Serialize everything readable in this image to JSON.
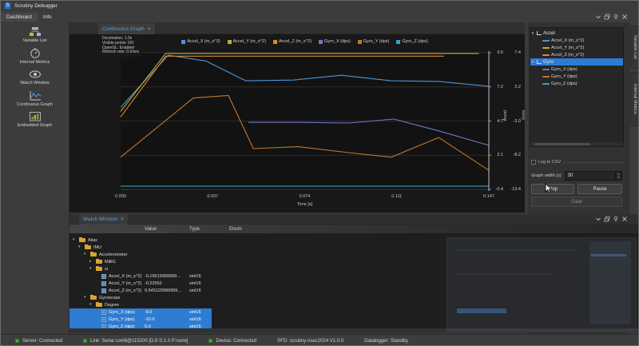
{
  "window": {
    "title": "Scrutiny Debugger",
    "app_initial": "S"
  },
  "menu": {
    "items": [
      "Dashboard",
      "Info"
    ]
  },
  "sidebar": {
    "items": [
      "Variable List",
      "Internal Metrics",
      "Watch Window",
      "Continuous Graph",
      "Embedded Graph"
    ]
  },
  "graph_dock": {
    "tab_label": "Continuous Graph",
    "close_glyph": "×",
    "overlay_lines": [
      "Decimation: 1.0x",
      "Visible points: 0/0",
      "OpenGL: Enabled",
      "Refresh rate: 0.0/sec"
    ],
    "x_label": "Time [s]"
  },
  "chart_data": {
    "type": "line",
    "title": "Continuous Graph",
    "xlabel": "Time [s]",
    "x_ticks": [
      "0.000",
      "0.037",
      "0.074",
      "0.111",
      "0.147"
    ],
    "grid": "horizontal",
    "legend_position": "top",
    "axes": [
      {
        "id": "accel",
        "label": "Accel",
        "ticks": [
          "9.6",
          "7.2",
          "4.7",
          "2.1",
          "-0.4"
        ]
      },
      {
        "id": "gyro",
        "label": "Gyro",
        "ticks": [
          "7.4",
          "2.2",
          "-3.0",
          "-8.2",
          "-13.4"
        ]
      }
    ],
    "series": [
      {
        "name": "Accel_X (m_s^2)",
        "axis": "accel",
        "color": "#4d94d8",
        "points": [
          [
            0.0,
            5.6
          ],
          [
            0.019,
            9.42
          ],
          [
            0.034,
            9.0
          ],
          [
            0.05,
            7.55
          ],
          [
            0.069,
            7.6
          ],
          [
            0.088,
            7.95
          ],
          [
            0.108,
            7.55
          ],
          [
            0.127,
            7.5
          ],
          [
            0.147,
            7.15
          ]
        ]
      },
      {
        "name": "Accel_Y (m_s^2)",
        "axis": "accel",
        "color": "#bfae34",
        "points": [
          [
            0.0,
            5.3
          ],
          [
            0.018,
            9.55
          ],
          [
            0.143,
            9.55
          ]
        ]
      },
      {
        "name": "Accel_Z (m_s^2)",
        "axis": "accel",
        "color": "#dd8830",
        "points": [
          [
            0.0,
            4.9
          ],
          [
            0.018,
            9.35
          ],
          [
            0.129,
            9.35
          ]
        ]
      },
      {
        "name": "Gyro_X (dps)",
        "axis": "gyro",
        "color": "#6d78cc",
        "points": [
          [
            0.051,
            -3.2
          ],
          [
            0.071,
            -3.2
          ],
          [
            0.091,
            -3.3
          ],
          [
            0.109,
            -2.7
          ],
          [
            0.127,
            -4.5
          ],
          [
            0.147,
            -6.7
          ]
        ]
      },
      {
        "name": "Gyro_Y (dps)",
        "axis": "gyro",
        "color": "#c07830",
        "points": [
          [
            0.0,
            -8.5
          ],
          [
            0.029,
            0.5
          ],
          [
            0.043,
            0.9
          ],
          [
            0.053,
            -7.2
          ],
          [
            0.071,
            -6.9
          ],
          [
            0.091,
            -7.8
          ],
          [
            0.108,
            -8.5
          ],
          [
            0.127,
            -5.5
          ],
          [
            0.147,
            -10.5
          ]
        ]
      },
      {
        "name": "Gyro_Z (dps)",
        "axis": "gyro",
        "color": "#3aa0cc",
        "points": [
          [
            0.0,
            -12.9
          ],
          [
            0.147,
            -12.9
          ]
        ]
      }
    ]
  },
  "signal_tree": {
    "groups": [
      {
        "label": "Accel",
        "selected": false,
        "children": [
          {
            "label": "Accel_X (m_s^2)",
            "color": "#4d94d8"
          },
          {
            "label": "Accel_Y (m_s^2)",
            "color": "#bfae34"
          },
          {
            "label": "Accel_Z (m_s^2)",
            "color": "#dd8830"
          }
        ]
      },
      {
        "label": "Gyro",
        "selected": true,
        "children": [
          {
            "label": "Gyro_X (dps)",
            "color": "#6d78cc"
          },
          {
            "label": "Gyro_Y (dps)",
            "color": "#c07830"
          },
          {
            "label": "Gyro_Z (dps)",
            "color": "#3aa0cc"
          }
        ]
      }
    ]
  },
  "right_controls": {
    "log_to_csv_label": "Log to CSV",
    "graph_width_label": "Graph width (s)",
    "graph_width_value": "30",
    "stop_label": "Stop",
    "pause_label": "Pause",
    "clear_label": "Clear"
  },
  "side_tabs": [
    "Variable List",
    "Internal Metrics"
  ],
  "watch_window": {
    "tab_label": "Watch Window",
    "close_glyph": "×",
    "columns": [
      "Value",
      "Type",
      "Enum"
    ],
    "rows": [
      {
        "label": "Alias",
        "kind": "folder",
        "depth": 0,
        "expanded": true
      },
      {
        "label": "IMU",
        "kind": "folder",
        "depth": 1,
        "expanded": true
      },
      {
        "label": "Accelerometer",
        "kind": "folder",
        "depth": 2,
        "expanded": true
      },
      {
        "label": "MilliG",
        "kind": "folder",
        "depth": 3,
        "expanded": false
      },
      {
        "label": "si",
        "kind": "folder",
        "depth": 3,
        "expanded": true
      },
      {
        "label": "Accel_X (m_s^2)",
        "kind": "var",
        "depth": 4,
        "value": "-0.19619999999...",
        "type": "sint16",
        "selected": false
      },
      {
        "label": "Accel_Y (m_s^2)",
        "kind": "var",
        "depth": 4,
        "value": "-0.22562",
        "type": "sint16",
        "selected": false
      },
      {
        "label": "Accel_Z (m_s^2)",
        "kind": "var",
        "depth": 4,
        "value": "9.545129999999...",
        "type": "sint16",
        "selected": false
      },
      {
        "label": "Gyroscope",
        "kind": "folder",
        "depth": 2,
        "expanded": true
      },
      {
        "label": "Degree",
        "kind": "folder",
        "depth": 3,
        "expanded": true
      },
      {
        "label": "Gyro_X (dps)",
        "kind": "var",
        "depth": 4,
        "value": "-9.0",
        "type": "sint16",
        "selected": true
      },
      {
        "label": "Gyro_Y (dps)",
        "kind": "var",
        "depth": 4,
        "value": "-10.0",
        "type": "sint16",
        "selected": true
      },
      {
        "label": "Gyro_Z (dps)",
        "kind": "var",
        "depth": 4,
        "value": "5.0",
        "type": "sint16",
        "selected": true
      }
    ]
  },
  "status_bar": {
    "led_color": "#4caf3e",
    "items": [
      {
        "led": true,
        "text": "Server: Connected"
      },
      {
        "led": true,
        "text": "Link: Serial com6@115200 [D:8 S:1.0 P:none]"
      },
      {
        "led": true,
        "text": "Device: Connected"
      },
      {
        "led": false,
        "text": "SFD: scrutiny-nsec2024 V1.0.0"
      },
      {
        "led": false,
        "text": "Datalogger: Standby"
      }
    ]
  },
  "colors": {
    "accent": "#2e7bd2",
    "tab_text": "#56a0e0",
    "status_led": "#4caf3e"
  }
}
